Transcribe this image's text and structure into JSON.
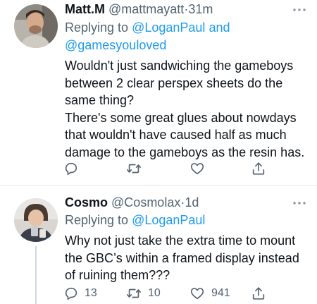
{
  "tweets": [
    {
      "name": "Matt.M",
      "handle": "@mattmayatt",
      "separator": "·",
      "time": "31m",
      "replying_prefix": "Replying to",
      "mention_1": "@LoganPaul",
      "conjunction": "and",
      "mention_2": "@gamesyouloved",
      "text_lines": [
        "Wouldn't just sandwiching the gameboys",
        "between 2 clear perspex sheets do the",
        "same thing?",
        "There's some great glues about nowdays",
        "that wouldn't have caused half as much",
        "damage to the gameboys as the resin has."
      ],
      "actions": {
        "reply_icon": "reply-icon",
        "retweet_icon": "retweet-icon",
        "like_icon": "heart-icon",
        "share_icon": "share-icon"
      }
    },
    {
      "name": "Cosmo",
      "handle": "@Cosmolax",
      "separator": "·",
      "time": "1d",
      "replying_prefix": "Replying to",
      "mention_1": "@LoganPaul",
      "text_lines": [
        "Why not just take the extra time to mount",
        "the GBC’s within a framed display instead",
        "of ruining them???"
      ],
      "actions": {
        "reply_count": "13",
        "retweet_count": "10",
        "like_count": "941",
        "reply_icon": "reply-icon",
        "retweet_icon": "retweet-icon",
        "like_icon": "heart-icon",
        "share_icon": "share-icon"
      }
    }
  ],
  "colors": {
    "text": "#0f1419",
    "secondary": "#536471",
    "link": "#1d9bf0",
    "divider": "#e6e9ec"
  }
}
